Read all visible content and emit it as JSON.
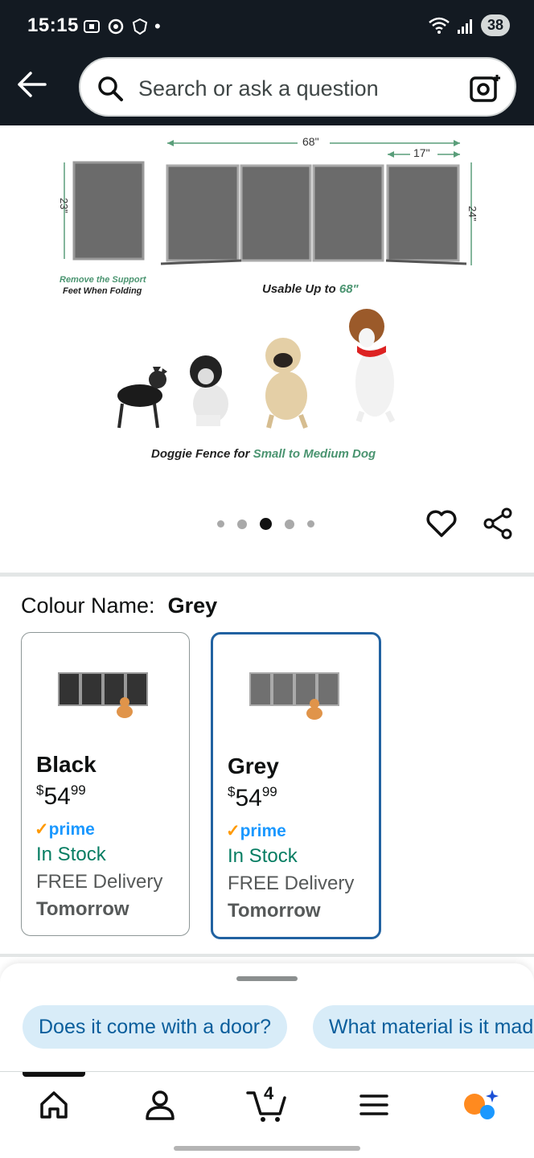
{
  "status_bar": {
    "time": "15:15",
    "battery": "38"
  },
  "search": {
    "placeholder": "Search or ask a question"
  },
  "product_image": {
    "dim_width": "68\"",
    "dim_panel": "17\"",
    "dim_height_left": "23\"",
    "dim_height_right": "24\"",
    "support_note_1": "Remove the Support",
    "support_note_2": "Feet When Folding",
    "usable_prefix": "Usable Up to ",
    "usable_value": "68\"",
    "doggie_prefix": "Doggie Fence for ",
    "doggie_accent": "Small to Medium Dog"
  },
  "carousel": {
    "count": 5,
    "active_index": 2
  },
  "colour": {
    "label": "Colour Name:",
    "selected": "Grey",
    "options": [
      {
        "name": "Black",
        "price_symbol": "$",
        "price_whole": "54",
        "price_cents": "99",
        "prime_check": "✓",
        "prime": "prime",
        "stock": "In Stock",
        "delivery": "FREE Delivery",
        "delivery_date": "Tomorrow",
        "panel_color": "#3a3a3a"
      },
      {
        "name": "Grey",
        "price_symbol": "$",
        "price_whole": "54",
        "price_cents": "99",
        "prime_check": "✓",
        "prime": "prime",
        "stock": "In Stock",
        "delivery": "FREE Delivery",
        "delivery_date": "Tomorrow",
        "panel_color": "#6f6f6f"
      }
    ]
  },
  "suggestions": [
    {
      "label": "Does it come with a door?"
    },
    {
      "label": "What material is it made of?"
    }
  ],
  "bottom_nav": {
    "cart_count": "4"
  },
  "colors": {
    "brand_dark": "#131a22",
    "accent_blue": "#2162a1",
    "stock_green": "#067d62",
    "prime_blue": "#1a98ff",
    "prime_orange": "#ff9900"
  }
}
